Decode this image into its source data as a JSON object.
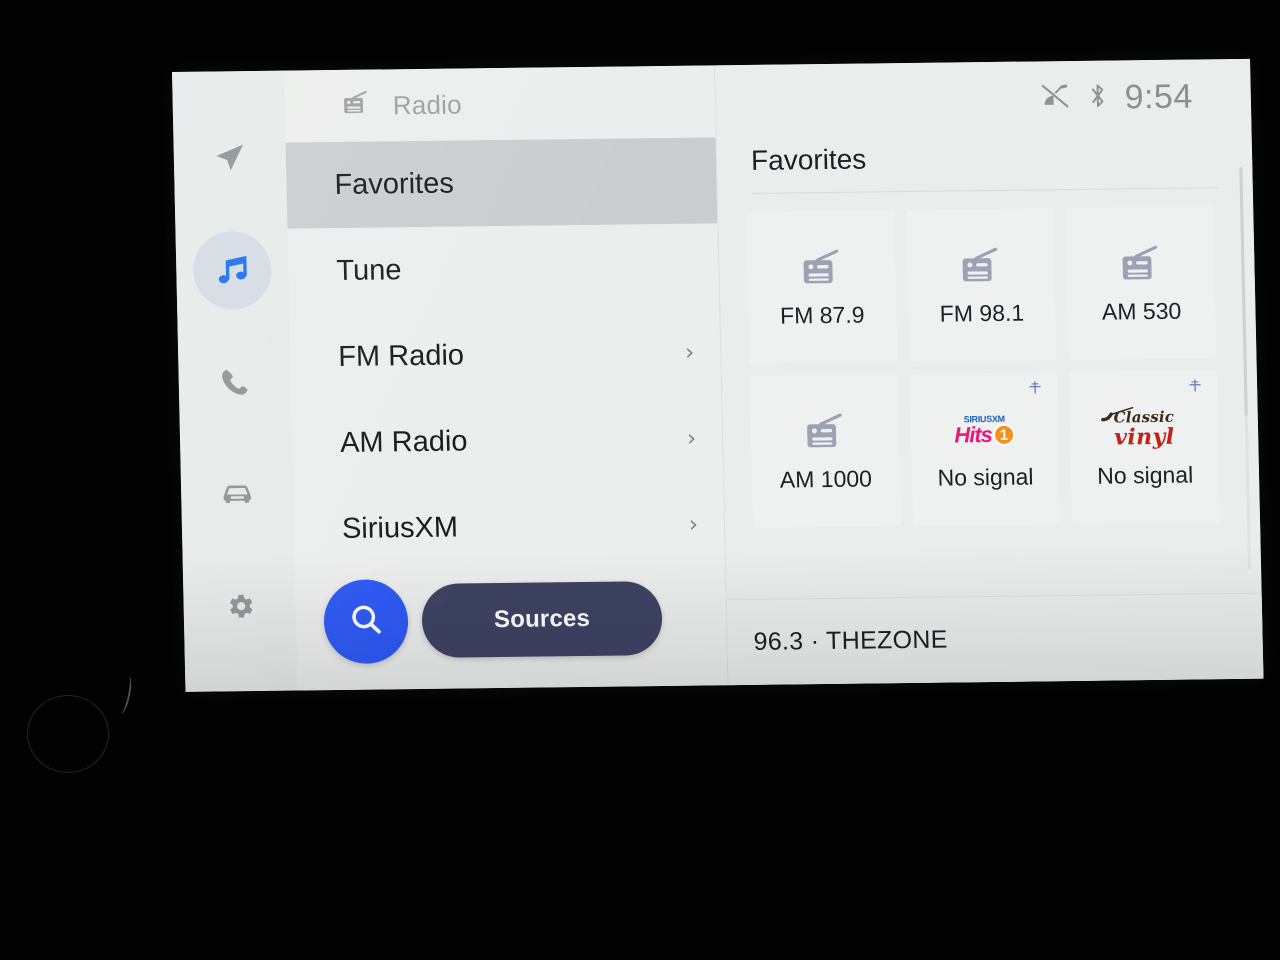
{
  "rail": {
    "items": [
      {
        "name": "navigation",
        "icon": "navigation-arrow-icon",
        "active": false
      },
      {
        "name": "media",
        "icon": "music-note-icon",
        "active": true
      },
      {
        "name": "phone",
        "icon": "phone-icon",
        "active": false
      },
      {
        "name": "vehicle",
        "icon": "car-icon",
        "active": false
      },
      {
        "name": "settings",
        "icon": "gear-icon",
        "active": false
      }
    ]
  },
  "source_pane": {
    "header_icon": "radio-icon",
    "header_title": "Radio",
    "menu": [
      {
        "label": "Favorites",
        "selected": true,
        "chevron": ""
      },
      {
        "label": "Tune",
        "selected": false,
        "chevron": ""
      },
      {
        "label": "FM Radio",
        "selected": false,
        "chevron": "›"
      },
      {
        "label": "AM Radio",
        "selected": false,
        "chevron": "›"
      },
      {
        "label": "SiriusXM",
        "selected": false,
        "chevron": "›"
      }
    ],
    "search_icon": "search-icon",
    "sources_label": "Sources"
  },
  "status_bar": {
    "satellite_icon": "satellite-off-icon",
    "bluetooth_icon": "bluetooth-icon",
    "time": "9:54"
  },
  "favorites": {
    "title": "Favorites",
    "tiles": [
      {
        "label": "FM 87.9",
        "art": "radio-icon",
        "sat": false
      },
      {
        "label": "FM 98.1",
        "art": "radio-icon",
        "sat": false
      },
      {
        "label": "AM 530",
        "art": "radio-icon",
        "sat": false
      },
      {
        "label": "AM 1000",
        "art": "radio-icon",
        "sat": false
      },
      {
        "label": "No signal",
        "art": "siriusxm-hits1-logo",
        "sat": true,
        "logo_text": {
          "top": "SIRIUSXM",
          "main": "Hits",
          "badge": "1"
        }
      },
      {
        "label": "No signal",
        "art": "classic-vinyl-logo",
        "sat": true,
        "logo_text": {
          "top": "Classic",
          "main": "vinyl"
        }
      }
    ]
  },
  "now_playing": {
    "text": "96.3 · THEZONE"
  },
  "colors": {
    "accent_blue": "#2b58f6",
    "sources_navy": "#3e4363",
    "screen_bg": "#e8eceb",
    "selected_row": "#c9cdcf",
    "icon_gray": "#8d9393"
  }
}
